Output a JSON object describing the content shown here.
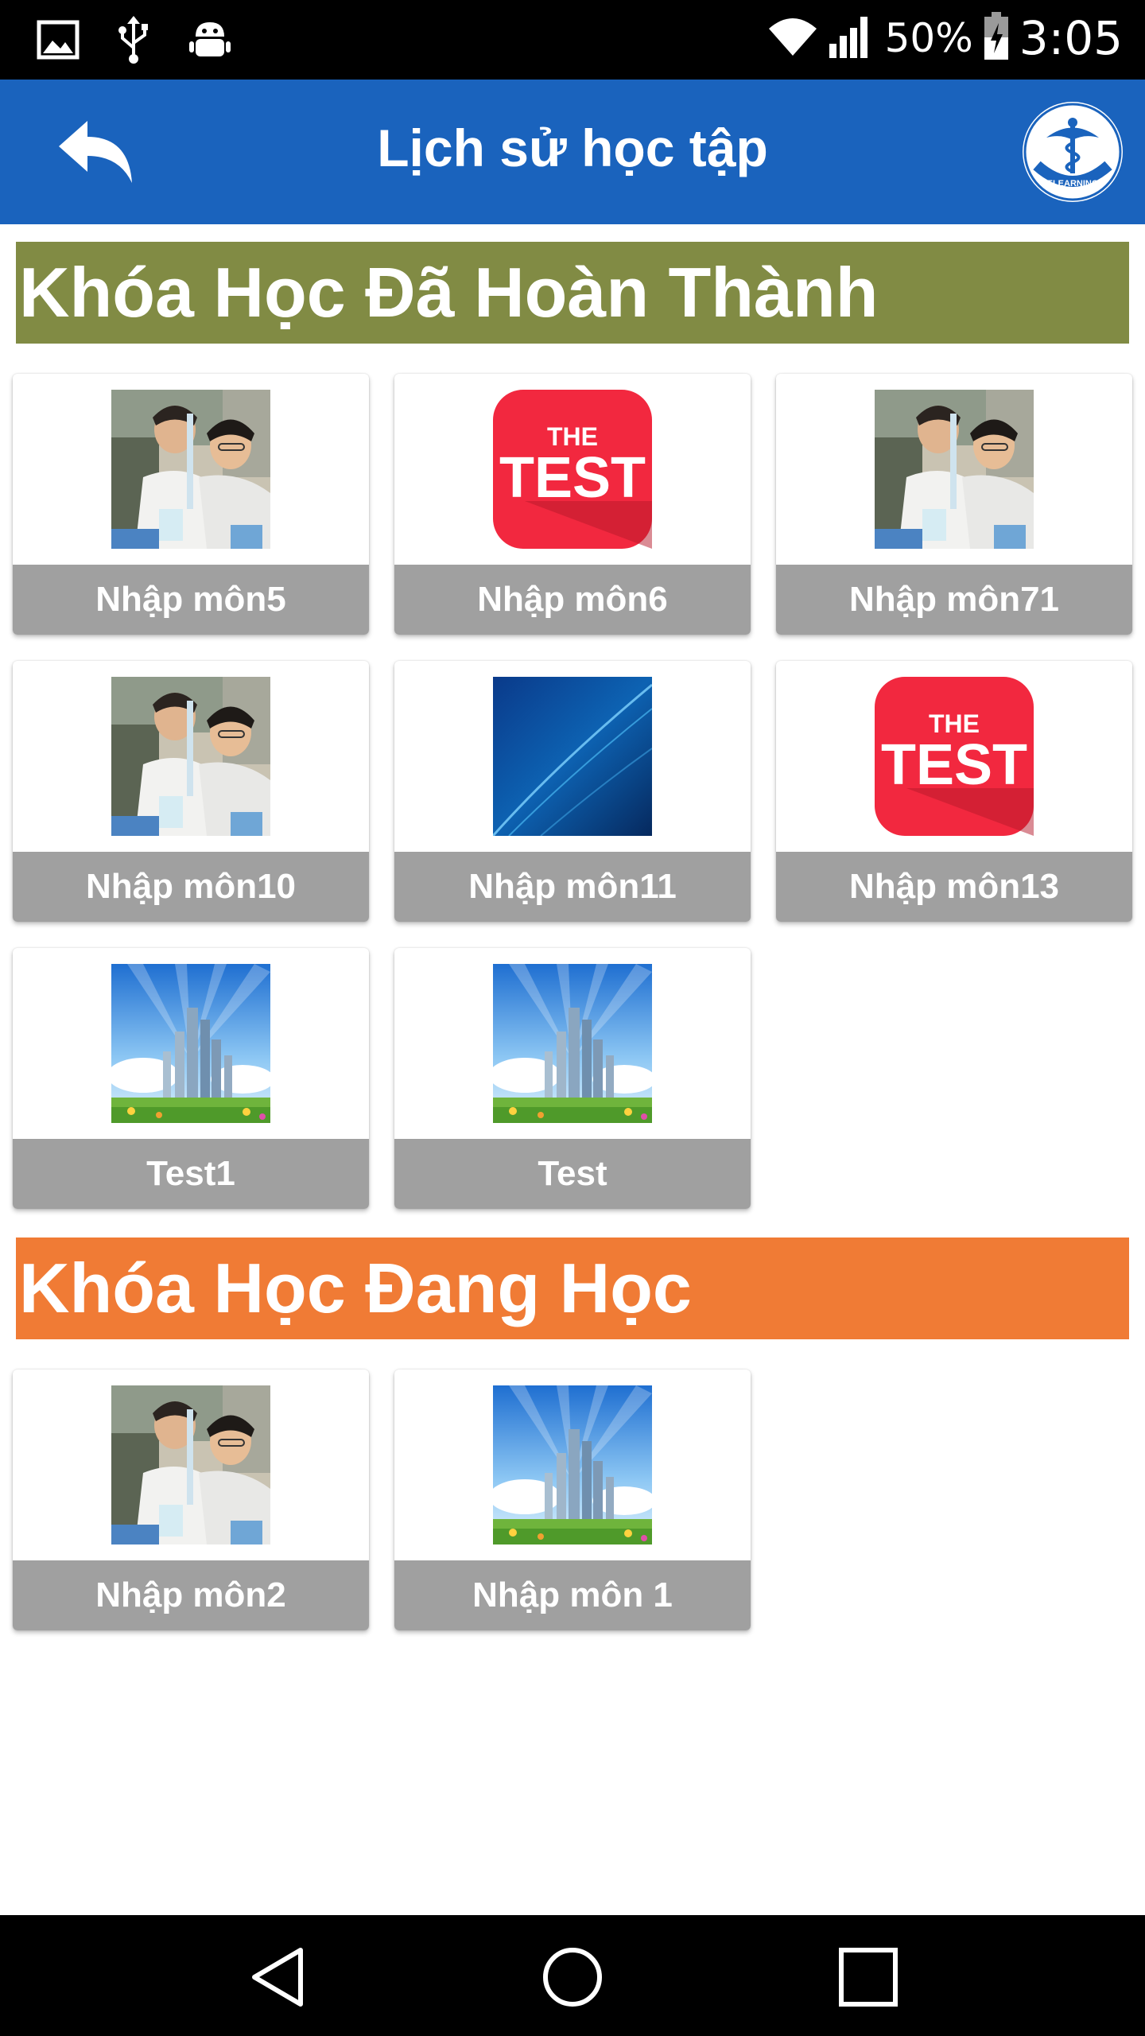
{
  "status_bar": {
    "battery_percent": "50%",
    "time": "3:05",
    "icons": [
      "image-icon",
      "usb-icon",
      "android-debug-icon",
      "wifi-icon",
      "signal-icon",
      "battery-icon"
    ]
  },
  "app_bar": {
    "title": "Lịch sử học tập",
    "back_icon": "reply-back-icon",
    "logo_text": "ELEARNING"
  },
  "sections": {
    "completed": {
      "title": "Khóa Học Đã Hoàn Thành",
      "color": "#818b44",
      "courses": [
        {
          "name": "Nhập môn5",
          "thumbnail": "lab-scientists"
        },
        {
          "name": "Nhập môn6",
          "thumbnail": "the-test"
        },
        {
          "name": "Nhập môn71",
          "thumbnail": "lab-scientists"
        },
        {
          "name": "Nhập môn10",
          "thumbnail": "lab-scientists"
        },
        {
          "name": "Nhập môn11",
          "thumbnail": "blue-abstract"
        },
        {
          "name": "Nhập môn13",
          "thumbnail": "the-test"
        },
        {
          "name": "Test1",
          "thumbnail": "city-skyline"
        },
        {
          "name": "Test",
          "thumbnail": "city-skyline"
        }
      ]
    },
    "learning": {
      "title": "Khóa Học Đang Học",
      "color": "#f07b35",
      "courses": [
        {
          "name": "Nhập môn2",
          "thumbnail": "lab-scientists"
        },
        {
          "name": "Nhập môn 1",
          "thumbnail": "city-skyline"
        }
      ]
    }
  },
  "thumbnail_text": {
    "the": "THE",
    "test": "TEST"
  },
  "nav_bar": {
    "buttons": [
      "back-triangle-icon",
      "home-circle-icon",
      "recents-square-icon"
    ]
  },
  "colors": {
    "app_bar": "#1a63bd",
    "card_label": "#a0a0a0"
  }
}
